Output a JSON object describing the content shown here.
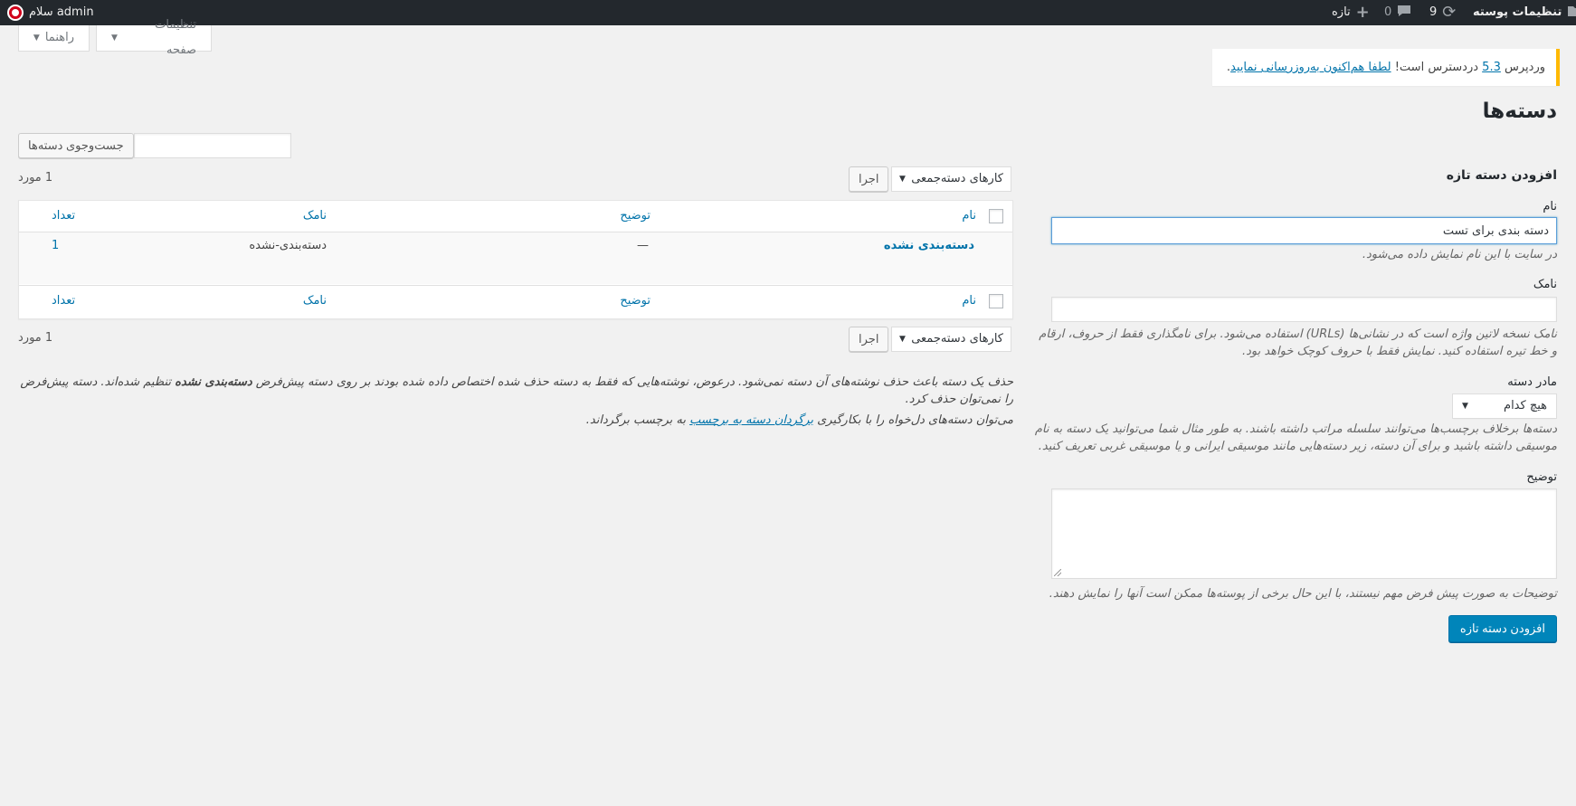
{
  "adminbar": {
    "site_name": "تنظیمات پوسته",
    "updates_count": "9",
    "comments_count": "0",
    "new_label": "تازه",
    "greeting": "سلام admin"
  },
  "screen_meta": {
    "screen_options": "تنظیمات صفحه",
    "help": "راهنما"
  },
  "notice": {
    "prefix": "وردپرس ",
    "version_link": "5.3",
    "middle": " دردسترس است! ",
    "update_link": "لطفا هم‌اکنون به‌روزرسانی نمایید",
    "suffix": "."
  },
  "page_title": "دسته‌ها",
  "form": {
    "title": "افزودن دسته تازه",
    "name_label": "نام",
    "name_value": "دسته بندی برای تست",
    "name_desc": "در سایت با این نام نمایش داده می‌شود.",
    "slug_label": "نامک",
    "slug_value": "",
    "slug_desc": "نامک نسخه لاتین واژه است که در نشانی‌ها (URLs) استفاده می‌شود. برای نامگذاری فقط از حروف، ارقام و خط تیره استفاده کنید. نمایش فقط با حروف کوچک خواهد بود.",
    "parent_label": "مادر دسته",
    "parent_value": "هیچ کدام",
    "parent_desc": "دسته‌ها برخلاف برچسب‌ها می‌توانند سلسله مراتب داشته باشند. به طور مثال شما می‌توانید یک دسته به نام موسیقی داشته باشید و برای آن دسته، زیر دسته‌هایی مانند موسیقی ایرانی و یا موسیقی غربی تعریف کنید.",
    "description_label": "توضیح",
    "description_desc": "توضیحات به صورت پیش فرض مهم نیستند، با این حال برخی از پوسته‌ها ممکن است آنها را نمایش دهند.",
    "submit": "افزودن دسته تازه"
  },
  "search": {
    "value": "",
    "button": "جست‌وجوی دسته‌ها"
  },
  "bulk": {
    "top_select": "کارهای دسته‌جمعی",
    "top_apply": "اجرا",
    "bottom_select": "کارهای دسته‌جمعی",
    "bottom_apply": "اجرا"
  },
  "items_count_top": "1 مورد",
  "items_count_bottom": "1 مورد",
  "table": {
    "columns": [
      "نام",
      "توضیح",
      "نامک",
      "تعداد"
    ],
    "rows": [
      {
        "name": "دسته‌بندی نشده",
        "description": "—",
        "slug": "دسته‌بندی-نشده",
        "count": "1"
      }
    ]
  },
  "notes": {
    "line1_a": "حذف یک دسته باعث حذف نوشته‌های آن دسته نمی‌شود. درعوض، نوشته‌هایی که فقط به دسته حذف شده اختصاص داده شده بودند بر روی دسته پیش‌فرض ",
    "line1_bold": "دسته‌بندی نشده",
    "line1_b": " تنظیم شده‌اند. دسته پیش‌فرض را نمی‌توان حذف کرد.",
    "line2_a": "می‌توان دسته‌های دل‌خواه را با بکارگیری ",
    "line2_link": "برگردان دسته به برچسب",
    "line2_b": " به برچسب برگرداند."
  }
}
